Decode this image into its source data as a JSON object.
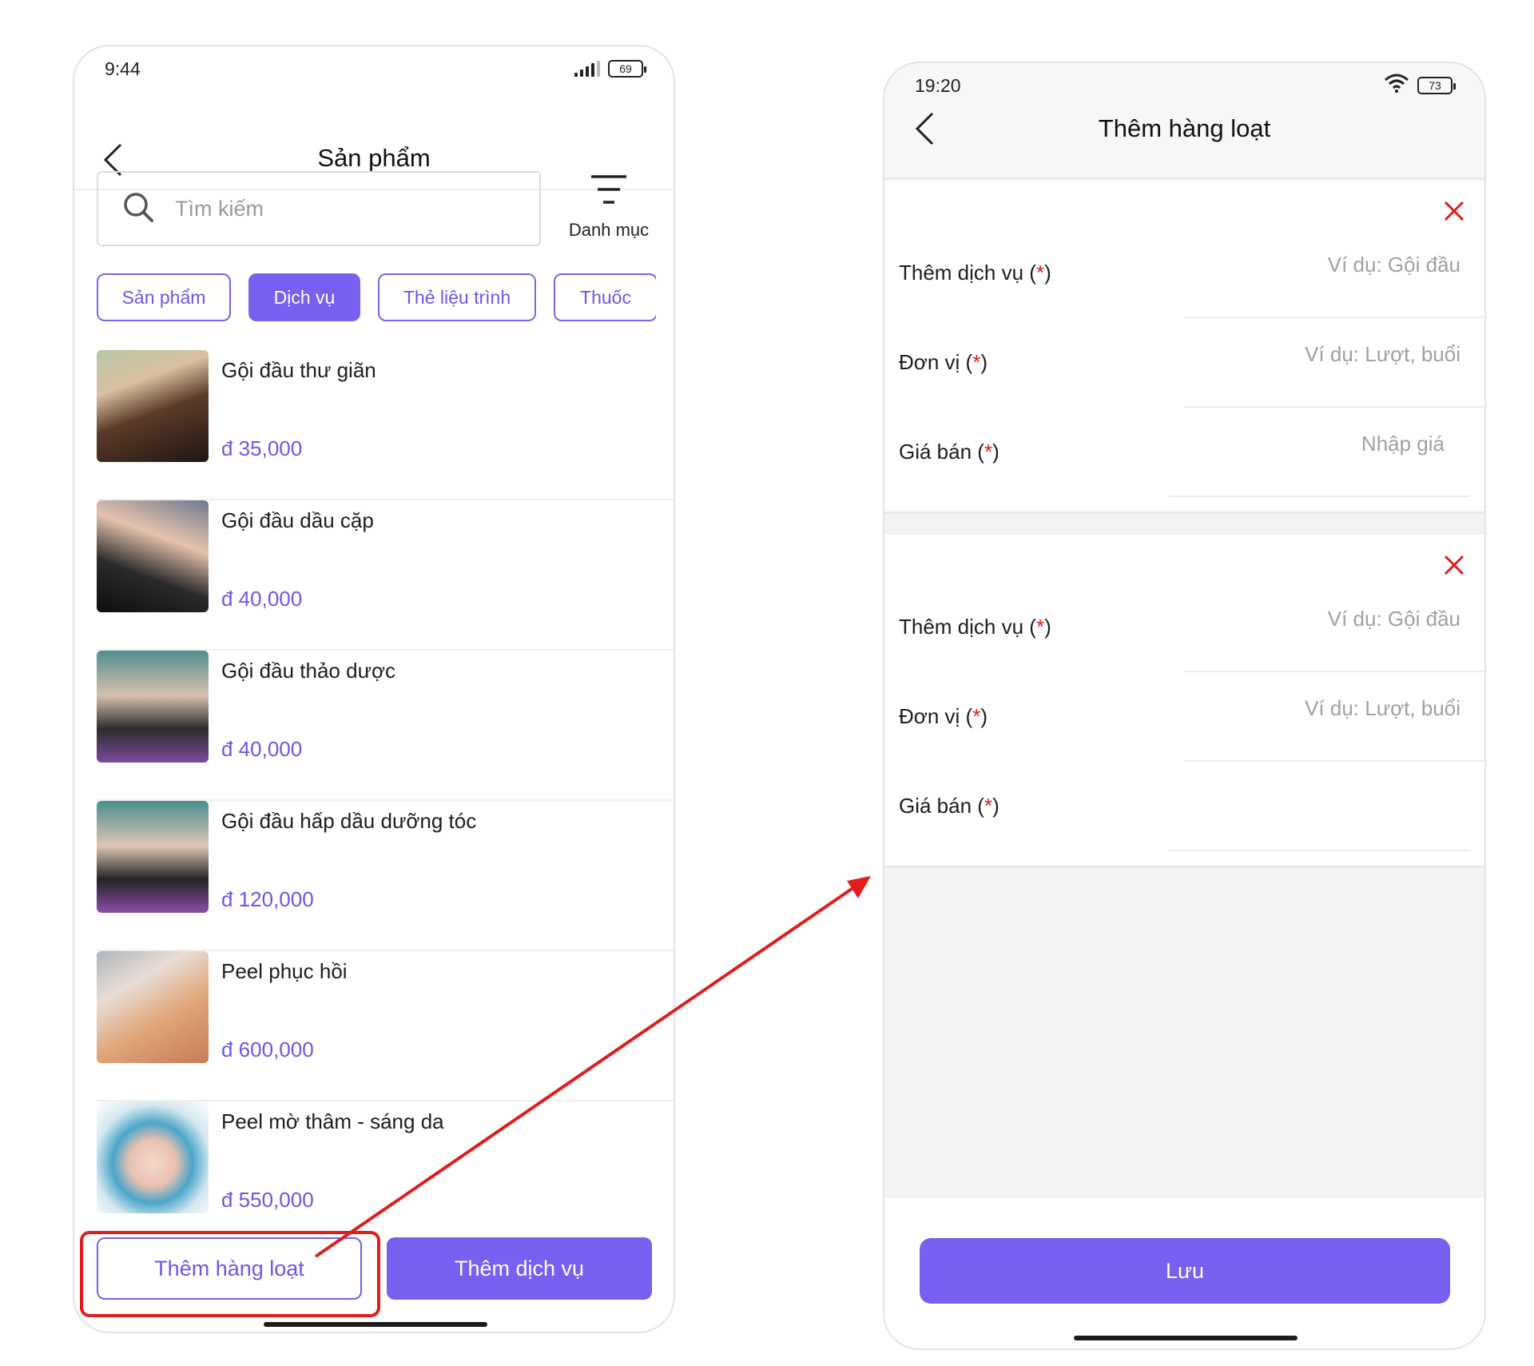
{
  "phone_list": {
    "status": {
      "time": "9:44",
      "battery": "69"
    },
    "title": "Sản phẩm",
    "search_placeholder": "Tìm kiếm",
    "filter_label": "Danh mục",
    "tabs": [
      {
        "label": "Sản phẩm",
        "active": false
      },
      {
        "label": "Dịch vụ",
        "active": true
      },
      {
        "label": "Thẻ liệu trình",
        "active": false
      },
      {
        "label": "Thuốc",
        "active": false
      }
    ],
    "items": [
      {
        "name": "Gội đầu thư giãn",
        "price": "đ 35,000"
      },
      {
        "name": "Gội đầu dầu cặp",
        "price": "đ 40,000"
      },
      {
        "name": "Gội đầu thảo dược",
        "price": "đ 40,000"
      },
      {
        "name": "Gội đầu hấp dầu dưỡng tóc",
        "price": "đ 120,000"
      },
      {
        "name": "Peel phục hồi",
        "price": "đ 600,000"
      },
      {
        "name": "Peel mờ thâm - sáng da",
        "price": "đ 550,000"
      }
    ],
    "bulk_add_button": "Thêm hàng loạt",
    "add_service_button": "Thêm dịch vụ"
  },
  "phone_bulk": {
    "status": {
      "time": "19:20",
      "battery": "73"
    },
    "title": "Thêm hàng loạt",
    "forms": [
      {
        "service_label": "Thêm dịch vụ",
        "service_placeholder": "Ví dụ: Gội đầu",
        "unit_label": "Đơn vị",
        "unit_placeholder": "Ví dụ: Lượt, buổi",
        "price_label": "Giá bán",
        "price_placeholder": "Nhập giá"
      },
      {
        "service_label": "Thêm dịch vụ",
        "service_placeholder": "Ví dụ: Gội đầu",
        "unit_label": "Đơn vị",
        "unit_placeholder": "Ví dụ: Lượt, buổi",
        "price_label": "Giá bán",
        "price_placeholder": ""
      }
    ],
    "required_mark": "*",
    "save_button": "Lưu"
  },
  "colors": {
    "accent": "#7560ef",
    "annotation": "#e21b1b"
  },
  "icons": [
    "back-icon",
    "search-icon",
    "filter-icon",
    "close-icon",
    "battery-icon",
    "signal-icon",
    "wifi-icon"
  ]
}
